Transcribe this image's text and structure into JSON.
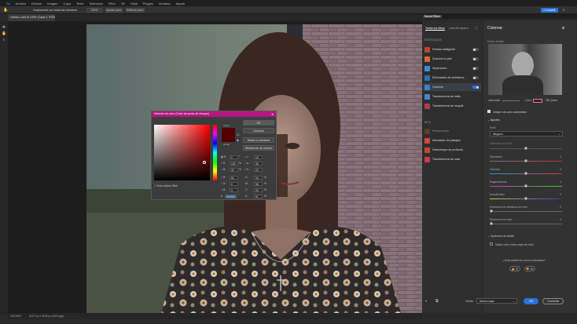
{
  "menu": [
    "Archivo",
    "Edición",
    "Imagen",
    "Capa",
    "Texto",
    "Selección",
    "Filtro",
    "3D",
    "Vista",
    "Plugins",
    "Ventana",
    "Ayuda"
  ],
  "options": {
    "display_all": "Desplazarse por todas las ventanas",
    "zoom": "100%",
    "fit": "Ajustar pant.",
    "fill": "Rellenar pant."
  },
  "top_right_button": "Compartir",
  "document_tab": "chama-1.psd al 100% (Capa 2, RGB/8#) *",
  "status": {
    "zoom": "100,00%",
    "doc_info": "4127 px x 3118 px (300 ppp)"
  },
  "color_picker": {
    "title": "Selector de color (Color de punto de retoque)",
    "ok": "OK",
    "cancel": "Cancelar",
    "add_swatches": "Añadir a muestras",
    "libraries": "Bibliotecas de colores",
    "new_label": "nuevo",
    "current_label": "actual",
    "web_only": "Solo colores Web",
    "hsb": [
      {
        "k": "H:",
        "v": "0",
        "u": "°"
      },
      {
        "k": "S:",
        "v": "100",
        "u": "%"
      },
      {
        "k": "B:",
        "v": "32",
        "u": "%"
      }
    ],
    "rgb": [
      {
        "k": "R:",
        "v": "82"
      },
      {
        "k": "G:",
        "v": "0"
      },
      {
        "k": "B:",
        "v": "0"
      }
    ],
    "lab": [
      {
        "k": "L:",
        "v": "15"
      },
      {
        "k": "a:",
        "v": "36"
      },
      {
        "k": "b:",
        "v": "24"
      }
    ],
    "cmyk": [
      {
        "k": "C:",
        "v": "34",
        "u": "%"
      },
      {
        "k": "M:",
        "v": "96",
        "u": "%"
      },
      {
        "k": "Y:",
        "v": "94",
        "u": "%"
      },
      {
        "k": "K:",
        "v": "57",
        "u": "%"
      }
    ],
    "hex": "520000",
    "new_color": "#520000",
    "current_color": "#520000"
  },
  "neural": {
    "panel_title": "Neural Filters",
    "tabs": [
      "Todos los filtros",
      "Lista de espera"
    ],
    "featured_header": "DESTACADOS",
    "featured": [
      {
        "label": "Retrato inteligente",
        "color": "#c2452d"
      },
      {
        "label": "Suavizar la piel",
        "color": "#d9683a"
      },
      {
        "label": "Superzoom",
        "color": "#3b8fd9"
      },
      {
        "label": "Eliminación de artefactos...",
        "color": "#2d6fb3"
      },
      {
        "label": "Colorear",
        "color": "#3b7fd4"
      },
      {
        "label": "Transferencia de estilo",
        "color": "#3d8bc9"
      },
      {
        "label": "Transferencia de maquill...",
        "color": "#b03a57"
      }
    ],
    "beta_header": "BETA",
    "beta": [
      {
        "label": "Restauración",
        "color": "#8a4a2a"
      },
      {
        "label": "Mezclador de paisajes",
        "color": "#d04a3a"
      },
      {
        "label": "Desenfoque de profundi...",
        "color": "#c24a2c"
      },
      {
        "label": "Transferencia de color",
        "color": "#c83c4a"
      }
    ],
    "right": {
      "title": "Colorear",
      "preview_label": "Puntos focales",
      "intensity": "Intensidad",
      "color": "Color",
      "remove": "Quitar",
      "auto_color": "Imagen de color automático",
      "adjust": "Ajustes",
      "profile_label": "Perfil",
      "profile_value": "Ninguno",
      "profile_strength": "Intensidad de perfil",
      "sliders": [
        {
          "label": "Saturación",
          "value": "0"
        },
        {
          "label": "Cian/rojo",
          "value": "0"
        },
        {
          "label": "Magenta/verde",
          "value": "0"
        },
        {
          "label": "Amarillo/azul",
          "value": "0"
        },
        {
          "label": "Reducción de artefactos de color",
          "value": "0"
        },
        {
          "label": "Reducción de ruido",
          "value": "0"
        }
      ],
      "output_options": "Opciones de salida",
      "output_new_layer": "Salida como nueva capa de color",
      "satisfied": "¿Está satisfecho con los resultados?",
      "yes": "Sí",
      "no": "No",
      "output_label": "Salida",
      "output_value": "Nueva capa",
      "ok": "OK",
      "cancel": "Cancelar"
    }
  }
}
